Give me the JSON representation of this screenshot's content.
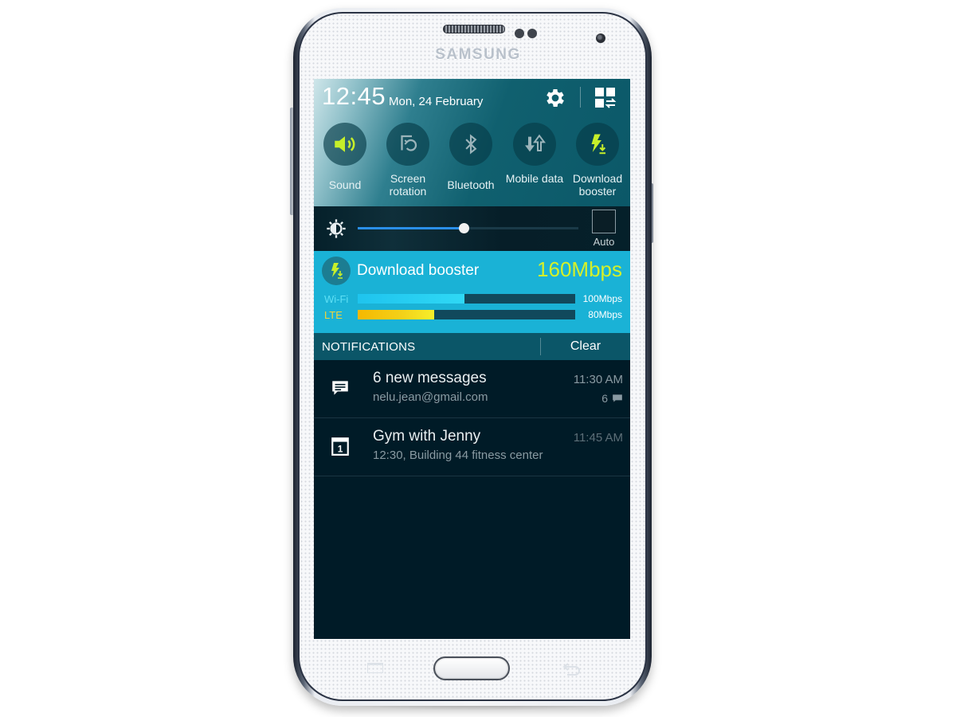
{
  "device": {
    "brand": "SAMSUNG"
  },
  "status": {
    "time": "12:45",
    "date": "Mon, 24 February"
  },
  "quick_panel": {
    "settings_icon": "gear-icon",
    "edit_icon": "grid-edit-icon",
    "toggles": [
      {
        "label": "Sound",
        "icon": "speaker-icon",
        "active": true
      },
      {
        "label": "Screen rotation",
        "icon": "screen-rotation-icon",
        "active": false
      },
      {
        "label": "Bluetooth",
        "icon": "bluetooth-icon",
        "active": false
      },
      {
        "label": "Mobile data",
        "icon": "mobile-data-icon",
        "active": false
      },
      {
        "label": "Download booster",
        "icon": "download-booster-icon",
        "active": true
      }
    ]
  },
  "brightness": {
    "level_percent": 48,
    "auto_label": "Auto",
    "auto_checked": false
  },
  "download_booster": {
    "title": "Download booster",
    "total_speed": "160Mbps",
    "connections": [
      {
        "name": "Wi-Fi",
        "speed": "100Mbps",
        "fill_percent": 49,
        "color": "#2fd8f5",
        "label_color": "#5ee0f5"
      },
      {
        "name": "LTE",
        "speed": "80Mbps",
        "fill_percent": 35,
        "color": "#f3d21a",
        "label_color": "#f0d43a"
      }
    ]
  },
  "notifications": {
    "header": "NOTIFICATIONS",
    "clear_label": "Clear",
    "items": [
      {
        "icon": "message-icon",
        "title": "6 new messages",
        "subtitle": "nelu.jean@gmail.com",
        "time": "11:30 AM",
        "count": "6"
      },
      {
        "icon": "calendar-icon",
        "title": "Gym with Jenny",
        "subtitle": "12:30, Building 44 fitness center",
        "time": "11:45 AM",
        "count": null
      }
    ]
  },
  "colors": {
    "accent_green": "#c6ef2a",
    "booster_bg": "#1ab2d6",
    "notif_bg": "#001b27",
    "slider_blue": "#2a8fe8"
  }
}
